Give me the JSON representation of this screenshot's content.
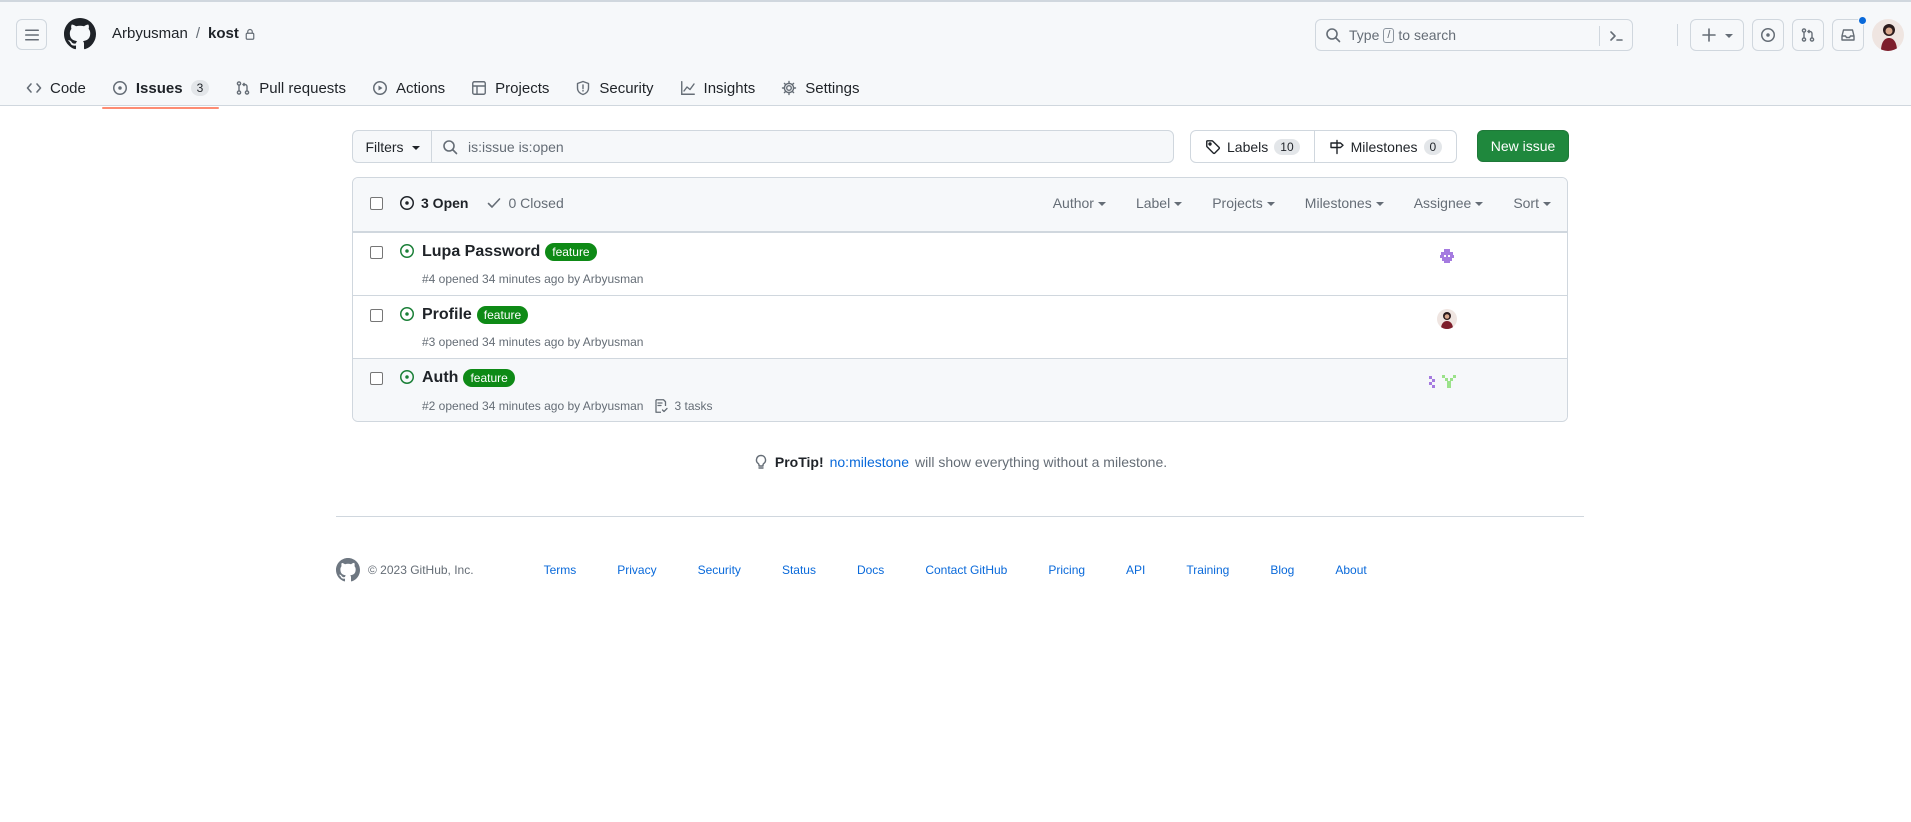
{
  "header": {
    "owner": "Arbyusman",
    "separator": "/",
    "repo": "kost",
    "search": {
      "prefix": "Type",
      "key": "/",
      "suffix": "to search"
    },
    "icons": [
      "hamburger-icon",
      "github-logo-icon",
      "lock-icon",
      "search-icon",
      "command-palette-icon",
      "plus-icon",
      "issue-opened-icon",
      "git-pull-request-icon",
      "inbox-icon"
    ],
    "notification_color": "#0969da"
  },
  "repo_nav": {
    "tabs": [
      {
        "label": "Code",
        "icon": "code-icon"
      },
      {
        "label": "Issues",
        "icon": "issue-opened-icon",
        "count": "3",
        "selected": true
      },
      {
        "label": "Pull requests",
        "icon": "git-pull-request-icon"
      },
      {
        "label": "Actions",
        "icon": "play-icon"
      },
      {
        "label": "Projects",
        "icon": "table-icon"
      },
      {
        "label": "Security",
        "icon": "shield-icon"
      },
      {
        "label": "Insights",
        "icon": "graph-icon"
      },
      {
        "label": "Settings",
        "icon": "gear-icon"
      }
    ],
    "selected_color": "#fd8c73"
  },
  "toolbar": {
    "filters_label": "Filters",
    "filter_value": "is:issue is:open",
    "labels_label": "Labels",
    "labels_count": "10",
    "milestones_label": "Milestones",
    "milestones_count": "0",
    "new_issue_label": "New issue",
    "new_issue_color": "#1f883d"
  },
  "list_header": {
    "open_label": "3 Open",
    "closed_label": "0 Closed",
    "dropdowns": [
      "Author",
      "Label",
      "Projects",
      "Milestones",
      "Assignee",
      "Sort"
    ]
  },
  "issues": [
    {
      "title": "Lupa Password",
      "label": "feature",
      "meta": "#4 opened 34 minutes ago by Arbyusman",
      "tasks": ""
    },
    {
      "title": "Profile",
      "label": "feature",
      "meta": "#3 opened 34 minutes ago by Arbyusman",
      "tasks": ""
    },
    {
      "title": "Auth",
      "label": "feature",
      "meta": "#2 opened 34 minutes ago by Arbyusman",
      "tasks": "3 tasks"
    }
  ],
  "label_color": "#0e8a16",
  "protip": {
    "strong": "ProTip!",
    "link": "no:milestone",
    "rest": "will show everything without a milestone."
  },
  "footer": {
    "copyright": "© 2023 GitHub, Inc.",
    "links": [
      "Terms",
      "Privacy",
      "Security",
      "Status",
      "Docs",
      "Contact GitHub",
      "Pricing",
      "API",
      "Training",
      "Blog",
      "About"
    ]
  }
}
